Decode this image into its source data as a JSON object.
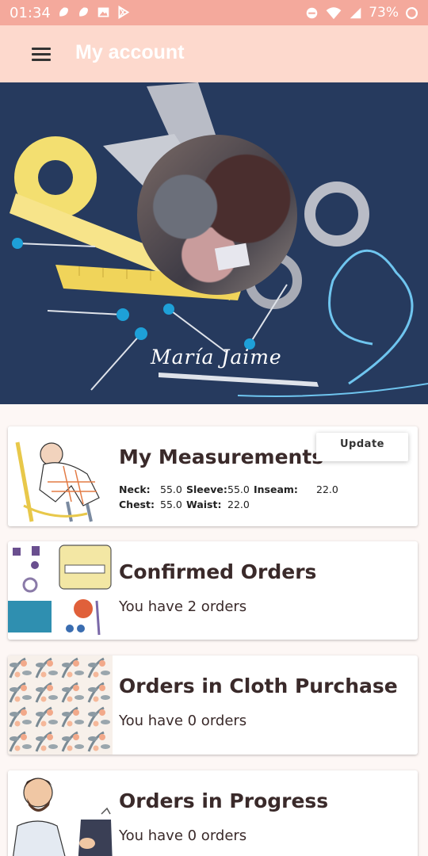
{
  "status_bar": {
    "time": "01:34",
    "battery_pct": "73%",
    "icons_left": [
      "notification-icon",
      "notification-icon",
      "image-icon",
      "play-store-icon"
    ],
    "icons_right": [
      "dnd-icon",
      "wifi-icon",
      "signal-icon",
      "battery-icon"
    ]
  },
  "app_bar": {
    "title": "My account",
    "menu_icon": "menu-icon"
  },
  "profile": {
    "name": "María Jaime"
  },
  "measurements": {
    "title": "My Measurements",
    "update_label": "Update",
    "neck_label": "Neck:",
    "neck_value": "55.0",
    "sleeve_label": "Sleeve:",
    "sleeve_value": "55.0",
    "inseam_label": "Inseam:",
    "inseam_value": "22.0",
    "chest_label": "Chest:",
    "chest_value": "55.0",
    "waist_label": "Waist:",
    "waist_value": "22.0"
  },
  "orders": [
    {
      "title": "Confirmed Orders",
      "subtitle": "You have 2 orders"
    },
    {
      "title": "Orders in Cloth Purchase",
      "subtitle": "You have 0 orders"
    },
    {
      "title": "Orders in Progress",
      "subtitle": "You have 0 orders"
    }
  ],
  "colors": {
    "status_bar": "#f4a99c",
    "app_bar": "#fdd9cd",
    "banner_bg": "#263a5e",
    "title_text": "#3a2a2a"
  }
}
